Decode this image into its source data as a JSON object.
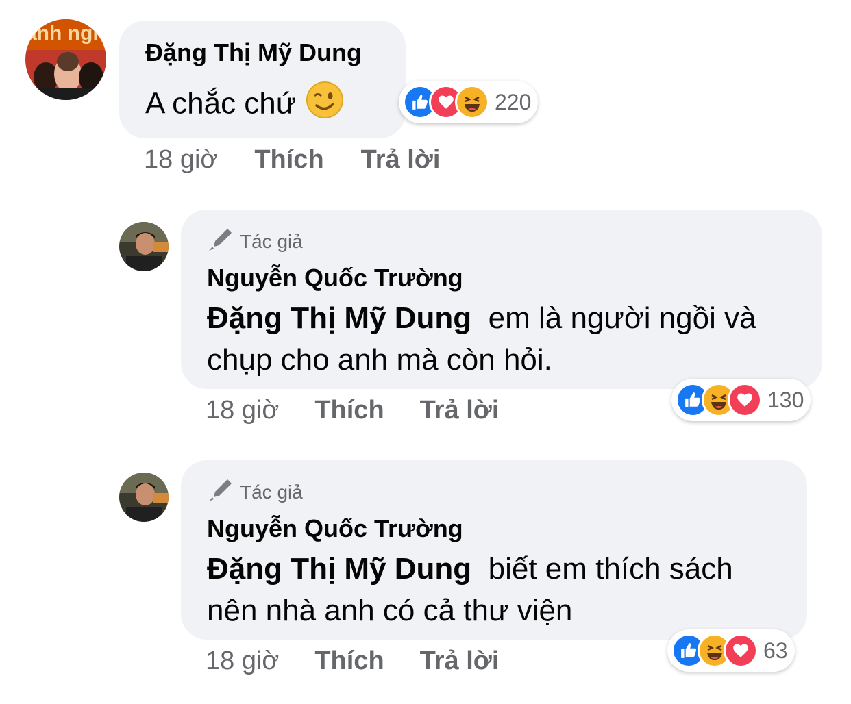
{
  "comments": [
    {
      "author": "Đặng Thị Mỹ Dung",
      "text": "A chắc chứ",
      "time": "18 giờ",
      "like_label": "Thích",
      "reply_label": "Trả lời",
      "reactions": [
        "like-icon",
        "love-icon",
        "haha-icon"
      ],
      "reaction_count": "220",
      "avatar_text": "anh nghi"
    },
    {
      "badge": "Tác giả",
      "author": "Nguyễn Quốc Trường",
      "mention": "Đặng Thị Mỹ Dung",
      "text_line1": "em là người ngồi và",
      "text_line2": "chụp cho anh mà còn hỏi.",
      "time": "18 giờ",
      "like_label": "Thích",
      "reply_label": "Trả lời",
      "reactions": [
        "like-icon",
        "haha-icon",
        "love-icon"
      ],
      "reaction_count": "130"
    },
    {
      "badge": "Tác giả",
      "author": "Nguyễn Quốc Trường",
      "mention": "Đặng Thị Mỹ Dung",
      "text_line1": "biết em thích sách",
      "text_line2": "nên nhà anh có cả thư viện",
      "time": "18 giờ",
      "like_label": "Thích",
      "reply_label": "Trả lời",
      "reactions": [
        "like-icon",
        "haha-icon",
        "love-icon"
      ],
      "reaction_count": "63"
    }
  ],
  "colors": {
    "bubble": "#f0f2f5",
    "like": "#1877f2",
    "love": "#f33e58",
    "haha": "#f7b125",
    "meta_text": "#65676b"
  }
}
